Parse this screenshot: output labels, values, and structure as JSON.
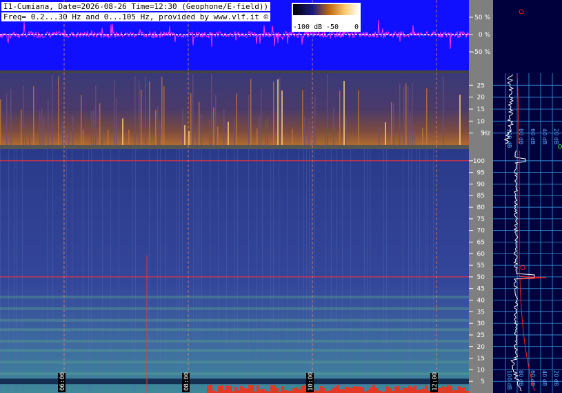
{
  "header": {
    "line1": "I1-Cumiana, Date=2026-08-26 Time=12:30 (Geophone/E-field))",
    "line2": "Freq= 0.2...30 Hz and 0...105 Hz, provided by www.vlf.it ©"
  },
  "colorbar": {
    "labels": [
      "-100 dB",
      "-50",
      "0"
    ]
  },
  "chart_data": [
    {
      "type": "line",
      "name": "amplitude-trace",
      "y_axis_labels": [
        "50 %",
        "0 %",
        "-50 %"
      ],
      "ylim": [
        -100,
        100
      ]
    },
    {
      "type": "heatmap",
      "name": "spectrogram-low",
      "y_ticks": [
        5,
        10,
        15,
        20,
        25
      ],
      "y_unit_label": "Hz",
      "ylim": [
        0.2,
        30
      ]
    },
    {
      "type": "heatmap",
      "name": "spectrogram-high",
      "y_ticks": [
        5,
        10,
        15,
        20,
        25,
        30,
        35,
        40,
        45,
        50,
        55,
        60,
        65,
        70,
        75,
        80,
        85,
        90,
        95,
        100
      ],
      "ylim": [
        0,
        105
      ],
      "x_ticks": [
        "06:00",
        "08:00",
        "10:00",
        "12:00"
      ],
      "highlight_lines_hz": [
        50,
        100
      ]
    },
    {
      "type": "line",
      "name": "spectrum-profile",
      "x_tick_labels": [
        "100 dB",
        "80 dB",
        "60 dB",
        "40 dB",
        "20 dB"
      ]
    }
  ],
  "colors": {
    "trace_bg": "#1010ff",
    "trace": "#ff30ff",
    "panel_bg": "#00003c",
    "grid": "#3aa0e6",
    "profile_red": "#ff2020"
  }
}
